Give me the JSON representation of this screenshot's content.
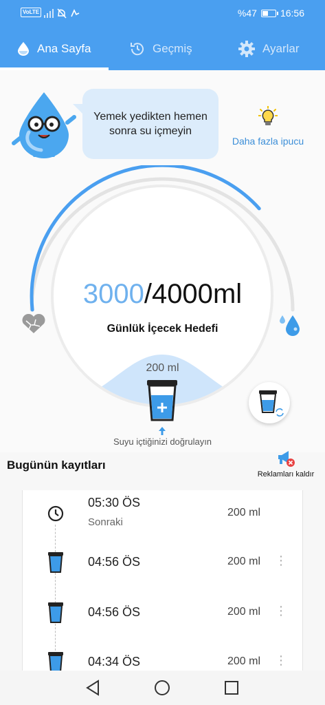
{
  "status": {
    "volte": "VoLTE",
    "battery_text": "%47",
    "battery_level": 0.47,
    "time": "16:56"
  },
  "tabs": [
    {
      "label": "Ana Sayfa",
      "icon": "water-drop-icon",
      "active": true
    },
    {
      "label": "Geçmiş",
      "icon": "history-icon",
      "active": false
    },
    {
      "label": "Ayarlar",
      "icon": "gear-icon",
      "active": false
    }
  ],
  "tip": {
    "bubble_text": "Yemek yedikten hemen sonra su içmeyin",
    "more_label": "Daha fazla ipucu",
    "icon": "lightbulb-icon"
  },
  "goal": {
    "consumed": "3000",
    "target": "/4000",
    "unit": "ml",
    "label": "Günlük İçecek Hedefi",
    "progress": 0.75
  },
  "cup": {
    "amount": "200 ml",
    "confirm_text": "Suyu içtiğinizi doğrulayın"
  },
  "records": {
    "title": "Bugünün kayıtları",
    "remove_ads": "Reklamları kaldır",
    "items": [
      {
        "time": "05:30 ÖS",
        "sub": "Sonraki",
        "ml": "200 ml",
        "icon": "clock-icon"
      },
      {
        "time": "04:56 ÖS",
        "ml": "200 ml",
        "icon": "cup-icon"
      },
      {
        "time": "04:56 ÖS",
        "ml": "200 ml",
        "icon": "cup-icon"
      },
      {
        "time": "04:34 ÖS",
        "ml": "200 ml",
        "icon": "cup-icon"
      }
    ]
  },
  "colors": {
    "primary": "#4a9ff0",
    "accent": "#6fb1ee",
    "bubble": "#dcecfb"
  }
}
